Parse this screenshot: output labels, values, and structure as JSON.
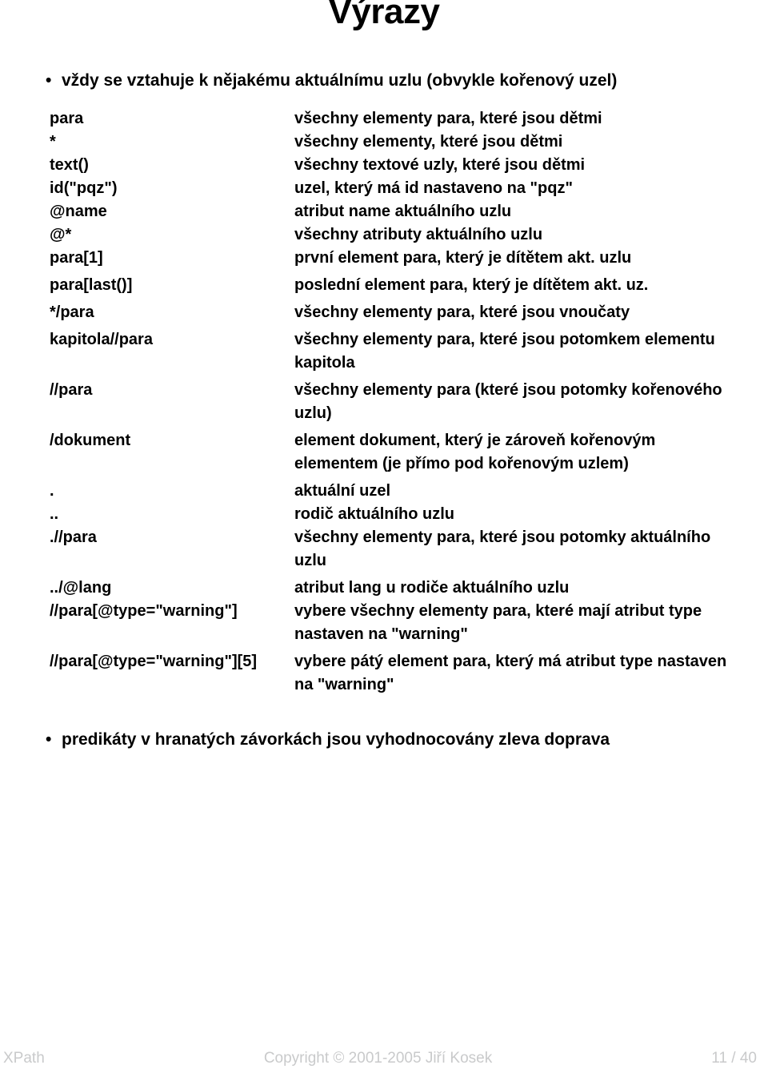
{
  "slide": {
    "title": "Výrazy",
    "bullet_glyph": "•",
    "top_bullet": "vždy se vztahuje k nějakému aktuálnímu uzlu (obvykle kořenový uzel)",
    "bottom_bullet": "predikáty v hranatých závorkách jsou vyhodnocovány zleva doprava"
  },
  "table": {
    "rows": [
      {
        "term": "para",
        "desc": "všechny elementy para, které jsou dětmi"
      },
      {
        "term": "*",
        "desc": "všechny elementy, které jsou dětmi"
      },
      {
        "term": "text()",
        "desc": "všechny textové uzly, které jsou dětmi"
      },
      {
        "term": "id(\"pqz\")",
        "desc": "uzel, který má id nastaveno na \"pqz\""
      },
      {
        "term": "@name",
        "desc": "atribut name aktuálního uzlu"
      },
      {
        "term": "@*",
        "desc": "všechny atributy aktuálního uzlu"
      },
      {
        "term": "para[1]",
        "desc": "první element para, který je dítětem akt. uzlu"
      },
      {
        "term": "para[last()]",
        "desc": "poslední element para, který je dítětem akt. uz."
      },
      {
        "term": "*/para",
        "desc": "všechny elementy para, které jsou vnoučaty"
      },
      {
        "term": "kapitola//para",
        "desc": "všechny elementy para, které jsou potomkem elementu kapitola"
      },
      {
        "term": "//para",
        "desc": "všechny elementy para (které jsou potomky kořenového uzlu)"
      },
      {
        "term": "/dokument",
        "desc": "element dokument, který je zároveň kořenovým elementem (je přímo pod kořenovým uzlem)"
      },
      {
        "term": ".",
        "desc": "aktuální uzel"
      },
      {
        "term": "..",
        "desc": "rodič aktuálního uzlu"
      },
      {
        "term": ".//para",
        "desc": "všechny elementy para, které jsou potomky aktuálního uzlu"
      },
      {
        "term": "../@lang",
        "desc": "atribut lang u rodiče aktuálního uzlu"
      },
      {
        "term": "//para[@type=\"warning\"]",
        "desc": "vybere všechny elementy para, které mají atribut type nastaven na \"warning\""
      },
      {
        "term": "//para[@type=\"warning\"][5]",
        "desc": "vybere pátý element para, který má atribut type nastaven na \"warning\""
      }
    ]
  },
  "footer": {
    "left": "XPath",
    "center": "Copyright © 2001-2005 Jiří Kosek",
    "right": "11 / 40",
    "color": "#c9cacb"
  }
}
